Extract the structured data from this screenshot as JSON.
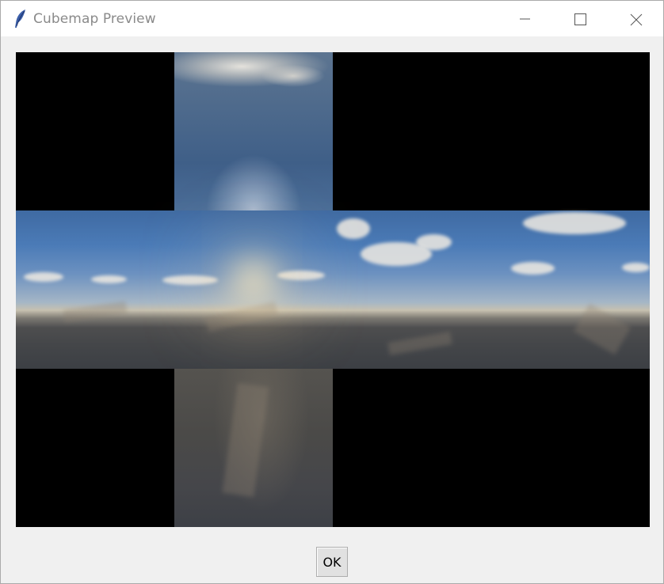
{
  "window": {
    "title": "Cubemap Preview",
    "icon": "feather-icon",
    "controls": [
      "minimize-icon",
      "maximize-icon",
      "close-icon"
    ]
  },
  "preview": {
    "layout": "cross",
    "faces": [
      "top",
      "left",
      "front",
      "right",
      "back",
      "bottom"
    ]
  },
  "buttons": {
    "ok_label": "OK"
  },
  "colors": {
    "titlebar": "#ffffff",
    "window_bg": "#f0f0f0",
    "preview_bg": "#000000"
  }
}
